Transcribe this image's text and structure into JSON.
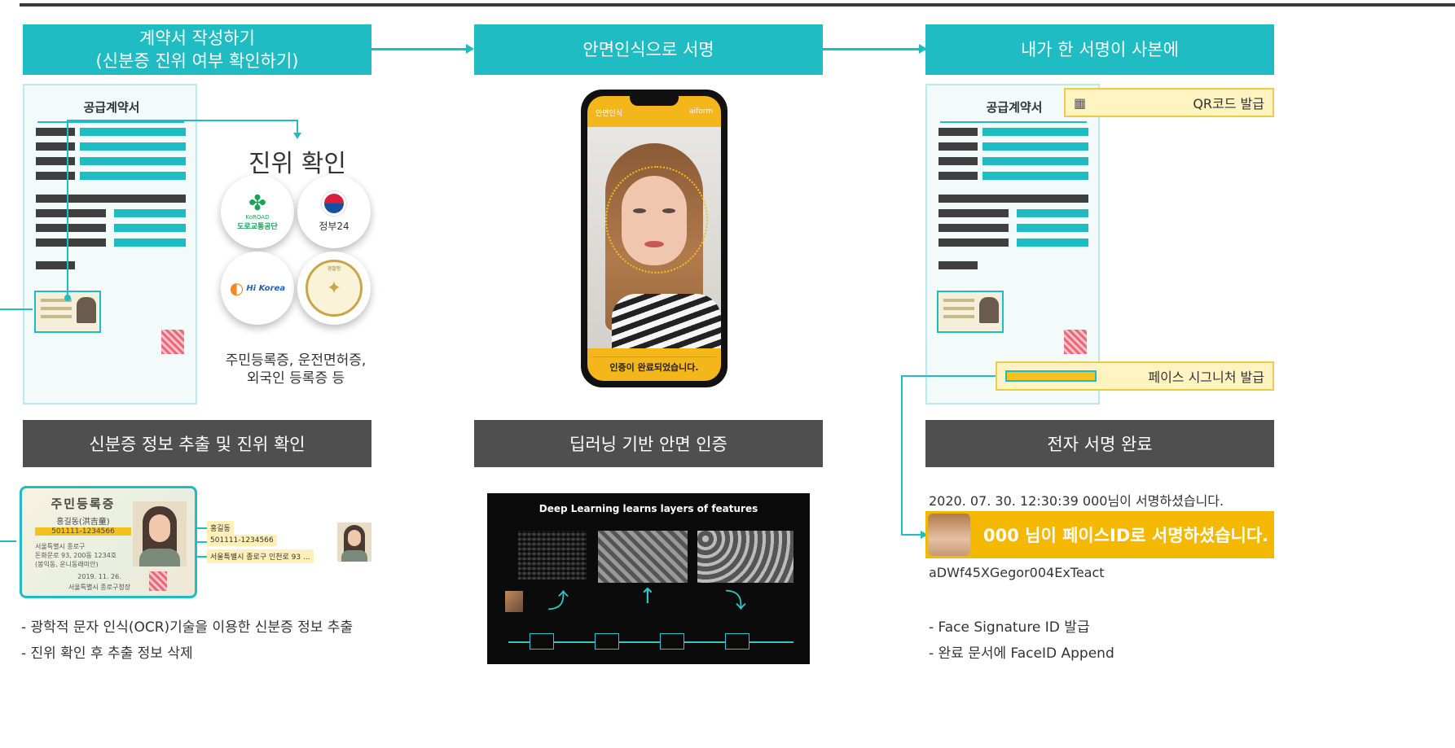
{
  "steps": {
    "step1": {
      "line1": "계약서 작성하기",
      "line2": "(신분증 진위 여부 확인하기)"
    },
    "step2": {
      "title": "안면인식으로 서명"
    },
    "step3": {
      "title": "내가 한 서명이 사본에"
    }
  },
  "document": {
    "title": "공급계약서"
  },
  "verify": {
    "heading": "진위 확인",
    "logos": [
      "도로교통공단",
      "정부24",
      "Hi Korea",
      "경찰청"
    ],
    "logo_sub": {
      "koroad": "KoROAD"
    },
    "caption_line1": "주민등록증, 운전면허증,",
    "caption_line2": "외국인 등록증 등"
  },
  "phone": {
    "app_label": "안면인식",
    "brand": "aiform",
    "status": "인증이 완료되었습니다."
  },
  "sections": {
    "s1": "신분증 정보 추출 및 진위 확인",
    "s2": "딥러닝 기반 안면 인증",
    "s3": "전자 서명 완료"
  },
  "idcard": {
    "title": "주민등록증",
    "name": "홍길동(洪吉童)",
    "number": "501111-1234566",
    "address1": "서울특별시 종로구",
    "address2": "돈화문로 93, 200동 1234호",
    "address3": "(봉익동, 운니동래미안)",
    "date": "2019. 11. 26.",
    "issuer": "서울특별시 종로구청장"
  },
  "extracted": {
    "name": "홍길동",
    "number": "501111-1234566",
    "address": "서울특별시 종로구 인천로 93 ..."
  },
  "dl": {
    "title": "Deep Learning learns layers of features"
  },
  "qr": {
    "label": "QR코드 발급"
  },
  "face_sig": {
    "label": "페이스 시그니처 발급"
  },
  "signature": {
    "log": "2020. 07. 30. 12:30:39 000님이 서명하셨습니다.",
    "banner": "000 님이 페이스ID로 서명하셨습니다.",
    "hash": "aDWf45XGegor004ExTeact"
  },
  "bullets_left": [
    "- 광학적 문자 인식(OCR)기술을 이용한 신분증 정보 추출",
    "- 진위 확인 후 추출 정보 삭제"
  ],
  "bullets_right": [
    "- Face Signature ID 발급",
    "- 완료 문서에 FaceID Append"
  ],
  "colors": {
    "teal": "#1fbcc4",
    "dark": "#4f4f4f",
    "yellow": "#f5b800"
  }
}
